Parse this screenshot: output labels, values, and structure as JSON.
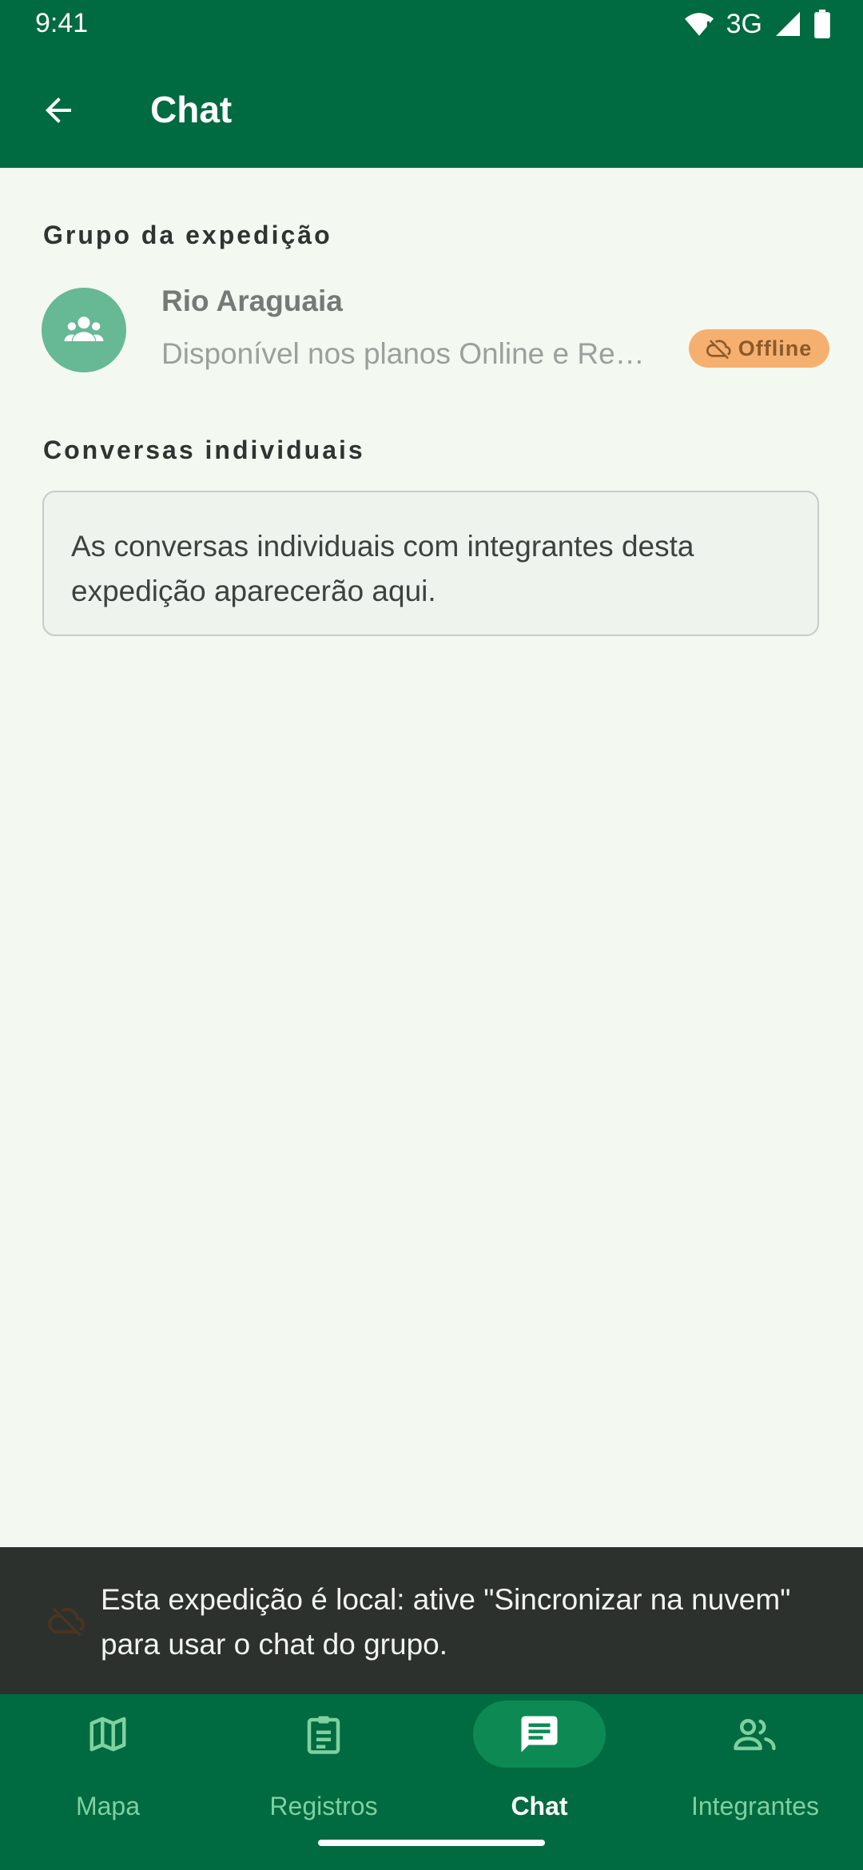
{
  "status_bar": {
    "time": "9:41",
    "network": "3G"
  },
  "app_bar": {
    "title": "Chat",
    "back_icon": "arrow-back-icon"
  },
  "sections": {
    "group_heading": "Grupo da expedição",
    "individual_heading": "Conversas individuais"
  },
  "group": {
    "name": "Rio Araguaia",
    "subtitle": "Disponível nos planos Online e Re…",
    "badge": "Offline",
    "avatar_icon": "group-icon"
  },
  "individual_empty_text": "As conversas individuais com integrantes desta expedição aparecerão aqui.",
  "snackbar": {
    "icon": "cloud-off-icon",
    "text": "Esta expedição é local: ative \"Sincronizar na nuvem\" para usar o chat do grupo."
  },
  "bottom_nav": [
    {
      "label": "Mapa",
      "icon": "map-icon"
    },
    {
      "label": "Registros",
      "icon": "clipboard-icon"
    },
    {
      "label": "Chat",
      "icon": "chat-icon",
      "active": true
    },
    {
      "label": "Integrantes",
      "icon": "people-icon"
    }
  ],
  "colors": {
    "primary": "#006A40",
    "background": "#F3F8F1",
    "avatar": "#67B894",
    "badge": "#F5B070",
    "snackbar": "#2C312E",
    "nav_active_pill": "#0D8A54",
    "nav_inactive_label": "#7fd0a0"
  }
}
